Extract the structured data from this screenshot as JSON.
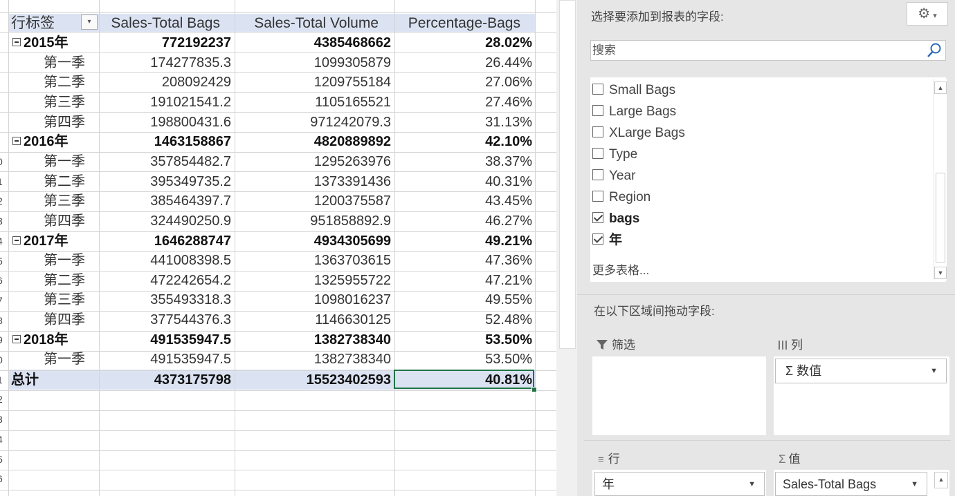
{
  "pivot": {
    "headers": {
      "row_label": "行标签",
      "total_bags": "Sales-Total Bags",
      "total_volume": "Sales-Total Volume",
      "pct_bags": "Percentage-Bags"
    },
    "rows": [
      {
        "label": "2015年",
        "bags": "772192237",
        "volume": "4385468662",
        "pct": "28.02%"
      },
      {
        "label": "第一季",
        "bags": "174277835.3",
        "volume": "1099305879",
        "pct": "26.44%"
      },
      {
        "label": "第二季",
        "bags": "208092429",
        "volume": "1209755184",
        "pct": "27.06%"
      },
      {
        "label": "第三季",
        "bags": "191021541.2",
        "volume": "1105165521",
        "pct": "27.46%"
      },
      {
        "label": "第四季",
        "bags": "198800431.6",
        "volume": "971242079.3",
        "pct": "31.13%"
      },
      {
        "label": "2016年",
        "bags": "1463158867",
        "volume": "4820889892",
        "pct": "42.10%"
      },
      {
        "label": "第一季",
        "bags": "357854482.7",
        "volume": "1295263976",
        "pct": "38.37%"
      },
      {
        "label": "第二季",
        "bags": "395349735.2",
        "volume": "1373391436",
        "pct": "40.31%"
      },
      {
        "label": "第三季",
        "bags": "385464397.7",
        "volume": "1200375587",
        "pct": "43.45%"
      },
      {
        "label": "第四季",
        "bags": "324490250.9",
        "volume": "951858892.9",
        "pct": "46.27%"
      },
      {
        "label": "2017年",
        "bags": "1646288747",
        "volume": "4934305699",
        "pct": "49.21%"
      },
      {
        "label": "第一季",
        "bags": "441008398.5",
        "volume": "1363703615",
        "pct": "47.36%"
      },
      {
        "label": "第二季",
        "bags": "472242654.2",
        "volume": "1325955722",
        "pct": "47.21%"
      },
      {
        "label": "第三季",
        "bags": "355493318.3",
        "volume": "1098016237",
        "pct": "49.55%"
      },
      {
        "label": "第四季",
        "bags": "377544376.3",
        "volume": "1146630125",
        "pct": "52.48%"
      },
      {
        "label": "2018年",
        "bags": "491535947.5",
        "volume": "1382738340",
        "pct": "53.50%"
      },
      {
        "label": "第一季",
        "bags": "491535947.5",
        "volume": "1382738340",
        "pct": "53.50%"
      }
    ],
    "grand_total": {
      "label": "总计",
      "bags": "4373175798",
      "volume": "15523402593",
      "pct": "40.81%"
    }
  },
  "row_header_fragments": [
    "0",
    "1",
    "2",
    "3",
    "4",
    "5",
    "6",
    "7",
    "8",
    "9",
    "0",
    "1",
    "2",
    "3",
    "4",
    "5",
    "6"
  ],
  "pane": {
    "choose_fields_label": "选择要添加到报表的字段:",
    "search_placeholder": "搜索",
    "fields": [
      {
        "name": "Small Bags",
        "checked": false
      },
      {
        "name": "Large Bags",
        "checked": false
      },
      {
        "name": "XLarge Bags",
        "checked": false
      },
      {
        "name": "Type",
        "checked": false
      },
      {
        "name": "Year",
        "checked": false
      },
      {
        "name": "Region",
        "checked": false
      },
      {
        "name": "bags",
        "checked": true
      },
      {
        "name": "年",
        "checked": true
      }
    ],
    "more_tables": "更多表格...",
    "drag_fields_label": "在以下区域间拖动字段:",
    "zones": {
      "filters_label": "筛选",
      "columns_label": "列",
      "columns_item": "Σ 数值",
      "rows_label": "行",
      "rows_item": "年",
      "values_label": "值",
      "values_item": "Sales-Total Bags"
    },
    "icons": {
      "gear": "gear-icon",
      "search": "search-icon",
      "filter": "filter-icon",
      "columns": "columns-icon",
      "rows": "rows-icon",
      "sigma": "sigma-icon"
    }
  }
}
